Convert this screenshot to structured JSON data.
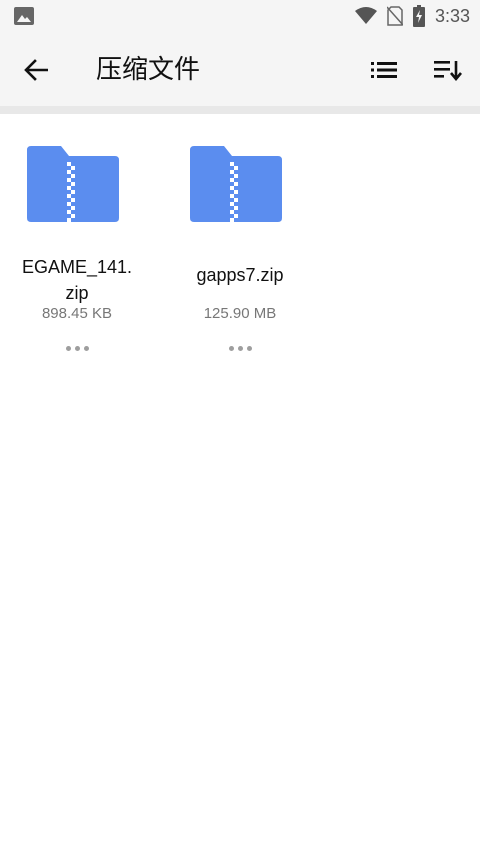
{
  "status_bar": {
    "time": "3:33",
    "icons": [
      "image-icon",
      "wifi-icon",
      "no-sim-icon",
      "battery-charging-icon"
    ]
  },
  "toolbar": {
    "title": "压缩文件",
    "icons": [
      "back-arrow-icon",
      "list-view-icon",
      "sort-icon"
    ]
  },
  "files": [
    {
      "name_line1": "EGAME_141.",
      "name_line2": "zip",
      "size": "898.45 KB",
      "icon": "zip-folder-icon"
    },
    {
      "name_line1": "gapps7.zip",
      "name_line2": "",
      "size": "125.90 MB",
      "icon": "zip-folder-icon"
    }
  ],
  "colors": {
    "folder": "#5b8def",
    "folder_tab": "#4a7ee6",
    "zipper": "#ffffff",
    "background": "#ffffff",
    "toolbar": "#f5f5f5"
  }
}
